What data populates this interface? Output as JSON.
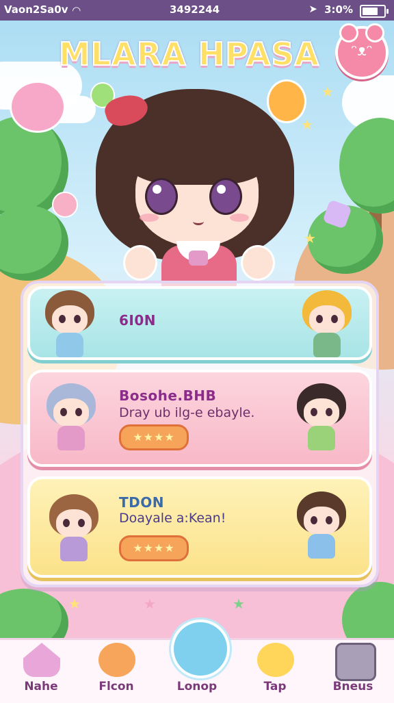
{
  "status_bar": {
    "carrier": "Vaon2Sa0v",
    "time": "3492244",
    "battery": "3:0%"
  },
  "game": {
    "title": "MLARA HPASA"
  },
  "cards": [
    {
      "title": "6I0N",
      "subtitle": "",
      "rating": "",
      "color": "#a8e4e6"
    },
    {
      "title": "Bosohe.BHB",
      "subtitle": "Dray ub ilg-e ebayle.",
      "rating": "★★★★",
      "color": "#f8b8c8"
    },
    {
      "title": "TDON",
      "subtitle": "Doayale a:Kean!",
      "rating": "★★★★",
      "color": "#fbe28a"
    }
  ],
  "nav": [
    {
      "label": "Nahe",
      "icon": "house-icon",
      "color": "#e9a6d8"
    },
    {
      "label": "Flcon",
      "icon": "orange-blob-icon",
      "color": "#f7a55a"
    },
    {
      "label": "Lonop",
      "icon": "blue-blob-icon",
      "color": "#7fd0ef"
    },
    {
      "label": "Tap",
      "icon": "yellow-cat-icon",
      "color": "#ffd65a"
    },
    {
      "label": "Bneus",
      "icon": "machine-icon",
      "color": "#a9a0b8"
    }
  ]
}
